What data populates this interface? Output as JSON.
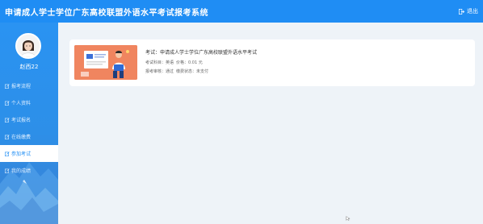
{
  "header": {
    "title": "申请成人学士学位广东高校联盟外语水平考试报考系统",
    "logout_label": "退出"
  },
  "sidebar": {
    "username": "赵西22",
    "items": [
      {
        "label": "报考流程",
        "active": false
      },
      {
        "label": "个人资料",
        "active": false
      },
      {
        "label": "考试报名",
        "active": false
      },
      {
        "label": "在线缴费",
        "active": false
      },
      {
        "label": "参加考试",
        "active": true
      },
      {
        "label": "我的成绩",
        "active": false
      }
    ]
  },
  "exam_card": {
    "title": "考试：申请成人学士学位广东高校联盟外语水平考试",
    "subject_label": "考试科目：",
    "subject_value": "英语",
    "price_label": "价格：",
    "price_value": "0.01 元",
    "review_label": "报考审核：",
    "review_value": "通过",
    "payment_label": "缴费状态：",
    "payment_value": "未支付"
  },
  "colors": {
    "primary": "#1f8df4",
    "card_thumb": "#f0855f",
    "background": "#eef3f8"
  }
}
